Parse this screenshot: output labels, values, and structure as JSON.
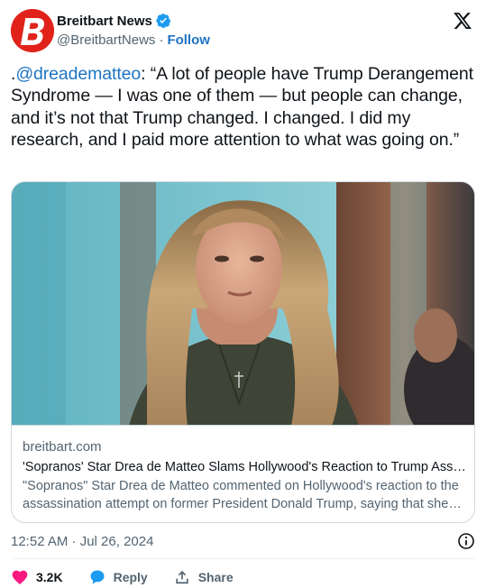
{
  "author": {
    "display_name": "Breitbart News",
    "handle": "@BreitbartNews",
    "separator": "·",
    "follow_label": "Follow",
    "avatar_letter": "B",
    "brand_color": "#e0221b",
    "verified_icon": "verified-badge-icon"
  },
  "tweet": {
    "prefix": ".",
    "mention": "@dreadematteo",
    "body": ": “A lot of people have Trump Derangement Syndrome — I was one of them — but people can change, and it’s not that Trump changed. I changed. I did my research, and I paid more attention to what was going on.”"
  },
  "card": {
    "domain": "breitbart.com",
    "title": "'Sopranos' Star Drea de Matteo Slams Hollywood's Reaction to Trump Assassination Attempt",
    "description": "\"Sopranos\" Star Drea de Matteo commented on Hollywood's reaction to the assassination attempt on former President Donald Trump, saying that she was disgusted."
  },
  "timestamp": "12:52 AM · Jul 26, 2024",
  "actions": {
    "like_count": "3.2K",
    "reply_label": "Reply",
    "share_label": "Share"
  },
  "colors": {
    "link": "#1d74c4",
    "like": "#f91880",
    "reply": "#1d9bf0",
    "muted": "#536471"
  }
}
